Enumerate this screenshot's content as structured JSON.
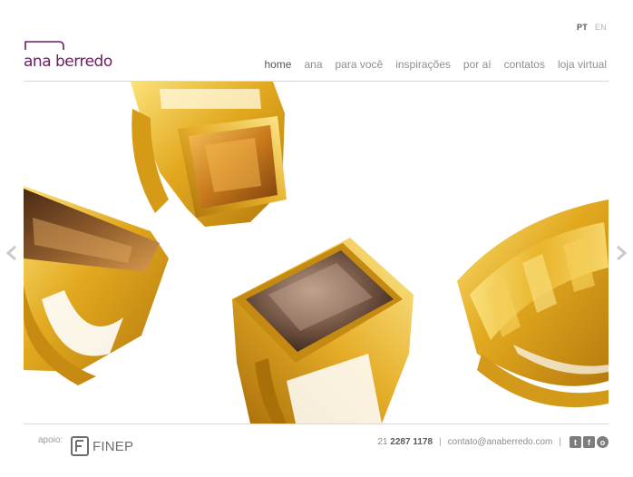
{
  "brand": {
    "name": "ana berredo",
    "color": "#6b1d63"
  },
  "languages": [
    {
      "code": "PT",
      "active": true
    },
    {
      "code": "EN",
      "active": false
    }
  ],
  "nav": [
    {
      "label": "home",
      "active": true
    },
    {
      "label": "ana",
      "active": false
    },
    {
      "label": "para você",
      "active": false
    },
    {
      "label": "inspirações",
      "active": false
    },
    {
      "label": "por aí",
      "active": false
    },
    {
      "label": "contatos",
      "active": false
    },
    {
      "label": "loja virtual",
      "active": false
    }
  ],
  "hero": {
    "content": "gold rings with gemstones",
    "prev_icon": "chevron-left-icon",
    "next_icon": "chevron-right-icon"
  },
  "footer": {
    "support_label": "apoio:",
    "sponsor": "FINEP",
    "phone_prefix": "21",
    "phone_number": "2287 1178",
    "separator": "|",
    "email": "contato@anaberredo.com",
    "social": [
      {
        "icon": "twitter-icon",
        "glyph": "t"
      },
      {
        "icon": "facebook-icon",
        "glyph": "f"
      },
      {
        "icon": "circle-icon",
        "glyph": "o"
      }
    ]
  }
}
